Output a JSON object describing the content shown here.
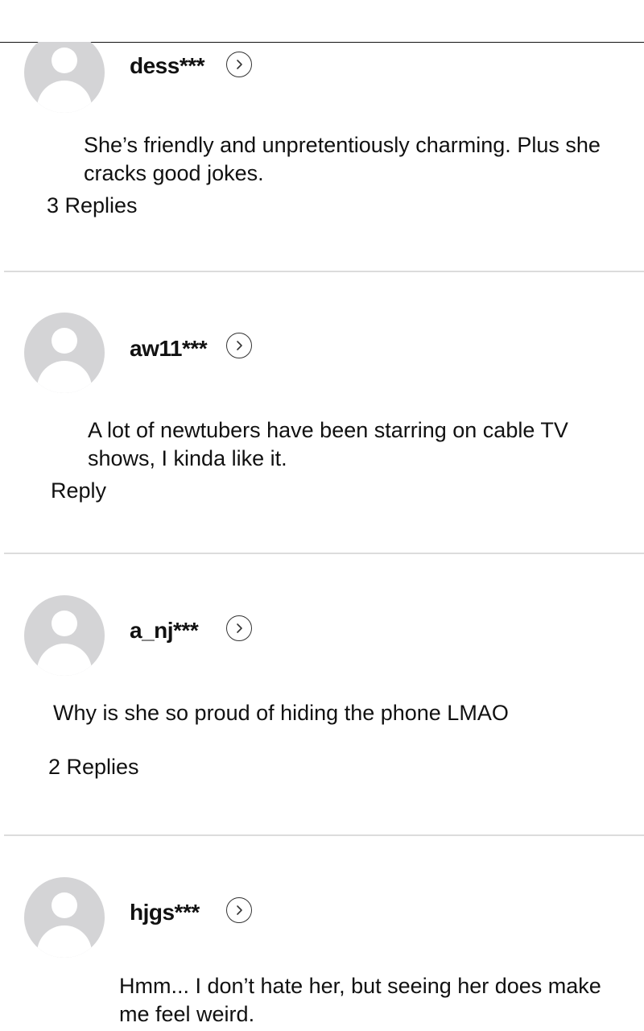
{
  "comments": [
    {
      "username": "dess***",
      "text_lines": [
        "She’s friendly and unpretentiously charming. Plus she",
        "cracks good jokes."
      ],
      "replies_label": "3 Replies"
    },
    {
      "username": "aw11***",
      "text_lines": [
        "A lot of newtubers have been starring on cable TV",
        "shows, I kinda like it."
      ],
      "replies_label": "Reply"
    },
    {
      "username": "a_nj***",
      "text_lines": [
        "Why is she so proud of hiding the phone LMAO"
      ],
      "replies_label": "2 Replies"
    },
    {
      "username": "hjgs***",
      "text_lines": [
        "Hmm... I don’t hate her, but seeing her does make",
        "me feel weird."
      ],
      "replies_label": ""
    }
  ],
  "icons": {
    "avatar": "default-user-avatar-icon",
    "profile_link": "chevron-right-circle-icon"
  },
  "colors": {
    "text": "#111111",
    "avatar_bg": "#d4d4d6",
    "divider": "#dcdcdc"
  }
}
